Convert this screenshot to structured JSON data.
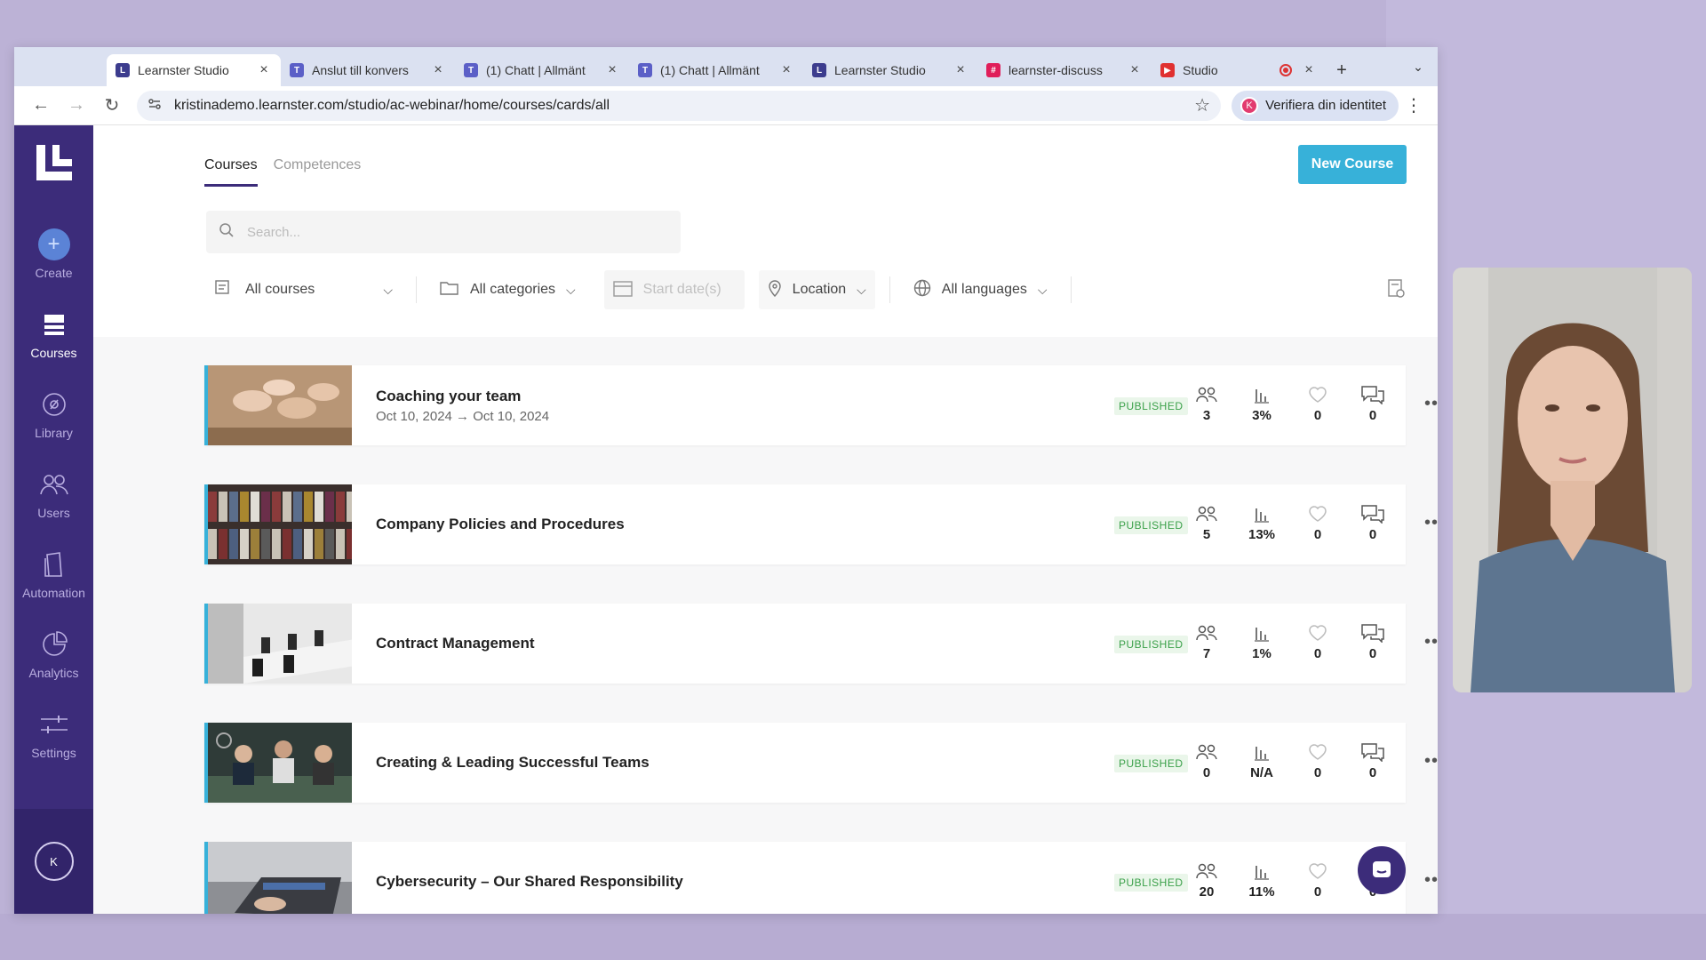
{
  "browser": {
    "tabs": [
      {
        "title": "Learnster Studio",
        "fav_color": "#3c3c8e",
        "fav_char": "L",
        "active": true
      },
      {
        "title": "Anslut till konvers",
        "fav_color": "#5b5fc7",
        "fav_char": "T",
        "active": false
      },
      {
        "title": "(1) Chatt | Allmänt",
        "fav_color": "#5b5fc7",
        "fav_char": "T",
        "active": false
      },
      {
        "title": "(1) Chatt | Allmänt",
        "fav_color": "#5b5fc7",
        "fav_char": "T",
        "active": false
      },
      {
        "title": "Learnster Studio",
        "fav_color": "#3c3c8e",
        "fav_char": "L",
        "active": false
      },
      {
        "title": "learnster-discuss",
        "fav_color": "#e01e5a",
        "fav_char": "#",
        "active": false
      },
      {
        "title": "Studio",
        "fav_color": "#e03030",
        "fav_char": "▶",
        "active": false
      }
    ],
    "url": "kristinademo.learnster.com/studio/ac-webinar/home/courses/cards/all",
    "verify_label": "Verifiera din identitet",
    "verify_avatar": "K"
  },
  "sidebar": {
    "items": [
      {
        "label": "Create",
        "icon": "plus-circle-icon",
        "active": false
      },
      {
        "label": "Courses",
        "icon": "courses-icon",
        "active": true
      },
      {
        "label": "Library",
        "icon": "library-icon",
        "active": false
      },
      {
        "label": "Users",
        "icon": "users-icon",
        "active": false
      },
      {
        "label": "Automation",
        "icon": "automation-icon",
        "active": false
      },
      {
        "label": "Analytics",
        "icon": "analytics-icon",
        "active": false
      },
      {
        "label": "Settings",
        "icon": "settings-icon",
        "active": false
      }
    ],
    "user_initials": "K"
  },
  "main": {
    "tabs": {
      "courses": "Courses",
      "competences": "Competences"
    },
    "new_course_label": "New Course",
    "search_placeholder": "Search...",
    "filters": {
      "courses": "All courses",
      "categories": "All categories",
      "start_date": "Start date(s)",
      "location": "Location",
      "languages": "All languages"
    },
    "courses": [
      {
        "title": "Coaching your team",
        "date": "Oct 10, 2024 → Oct 10, 2024",
        "status": "PUBLISHED",
        "users": "3",
        "progress": "3%",
        "likes": "0",
        "comments": "0",
        "thumb": "hands"
      },
      {
        "title": "Company Policies and Procedures",
        "date": "",
        "status": "PUBLISHED",
        "users": "5",
        "progress": "13%",
        "likes": "0",
        "comments": "0",
        "thumb": "binders"
      },
      {
        "title": "Contract Management",
        "date": "",
        "status": "PUBLISHED",
        "users": "7",
        "progress": "1%",
        "likes": "0",
        "comments": "0",
        "thumb": "boardroom"
      },
      {
        "title": "Creating & Leading Successful Teams",
        "date": "",
        "status": "PUBLISHED",
        "users": "0",
        "progress": "N/A",
        "likes": "0",
        "comments": "0",
        "thumb": "team"
      },
      {
        "title": "Cybersecurity – Our Shared Responsibility",
        "date": "",
        "status": "PUBLISHED",
        "users": "20",
        "progress": "11%",
        "likes": "0",
        "comments": "0",
        "thumb": "laptop"
      }
    ]
  },
  "colors": {
    "sidebar": "#3c2c7a",
    "accent": "#37b1d9",
    "published": "#3aa049"
  }
}
